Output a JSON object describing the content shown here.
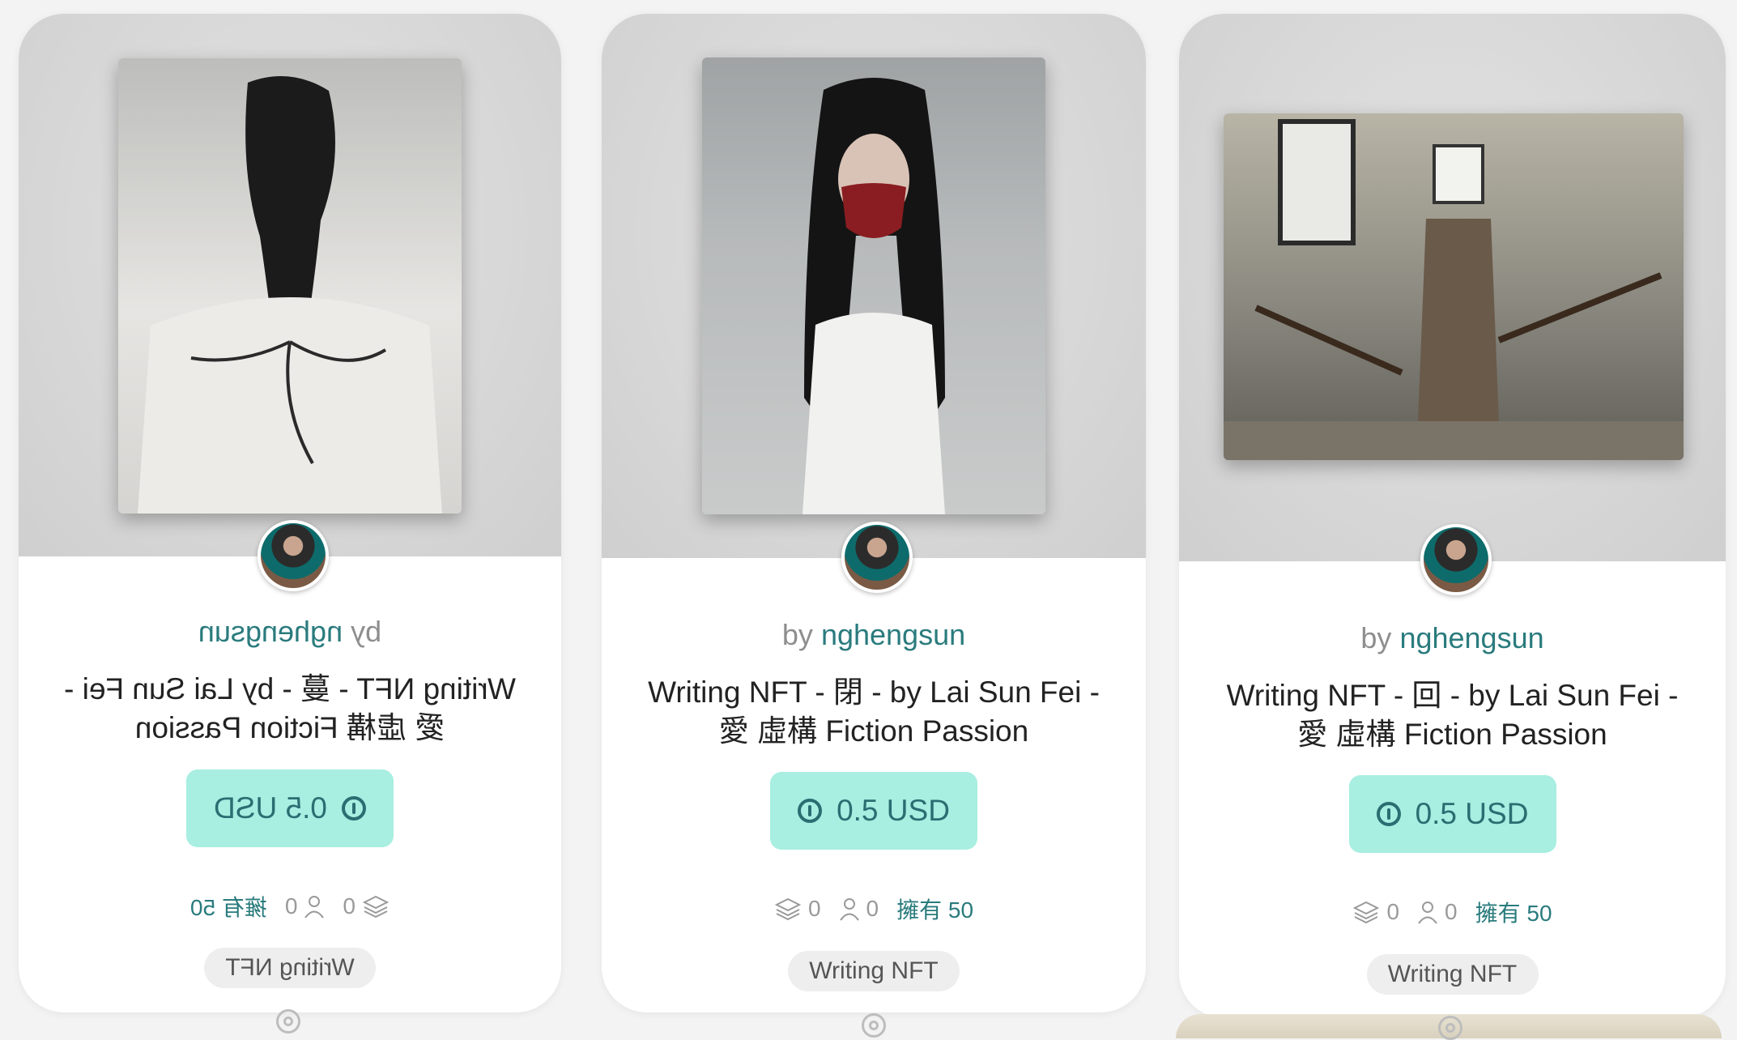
{
  "cards": [
    {
      "by": "by",
      "user": "nghengsun",
      "title": "Writing NFT - 蔓 - by Lai Sun Fei - 愛 虛構 Fiction Passion",
      "price": "0.5 USD",
      "layers_count": "0",
      "owners_count": "0",
      "own_label": "擁有 50",
      "tag": "Writing NFT",
      "mirrored": true
    },
    {
      "by": "by",
      "user": "nghengsun",
      "title": "Writing NFT - 閉 - by Lai Sun Fei - 愛 虛構 Fiction Passion",
      "price": "0.5 USD",
      "layers_count": "0",
      "owners_count": "0",
      "own_label": "擁有 50",
      "tag": "Writing NFT",
      "mirrored": false
    },
    {
      "by": "by",
      "user": "nghengsun",
      "title": "Writing NFT - 回 - by Lai Sun Fei - 愛 虛構 Fiction Passion",
      "price": "0.5 USD",
      "layers_count": "0",
      "owners_count": "0",
      "own_label": "擁有 50",
      "tag": "Writing NFT",
      "mirrored": false
    }
  ],
  "icons": [
    "coin-icon",
    "layers-icon",
    "person-icon",
    "target-icon"
  ],
  "colors": {
    "accent": "#2a7b7d",
    "price_button_bg": "#a8eee1",
    "tag_bg": "#eeeeee",
    "card_bg": "#ffffff"
  }
}
